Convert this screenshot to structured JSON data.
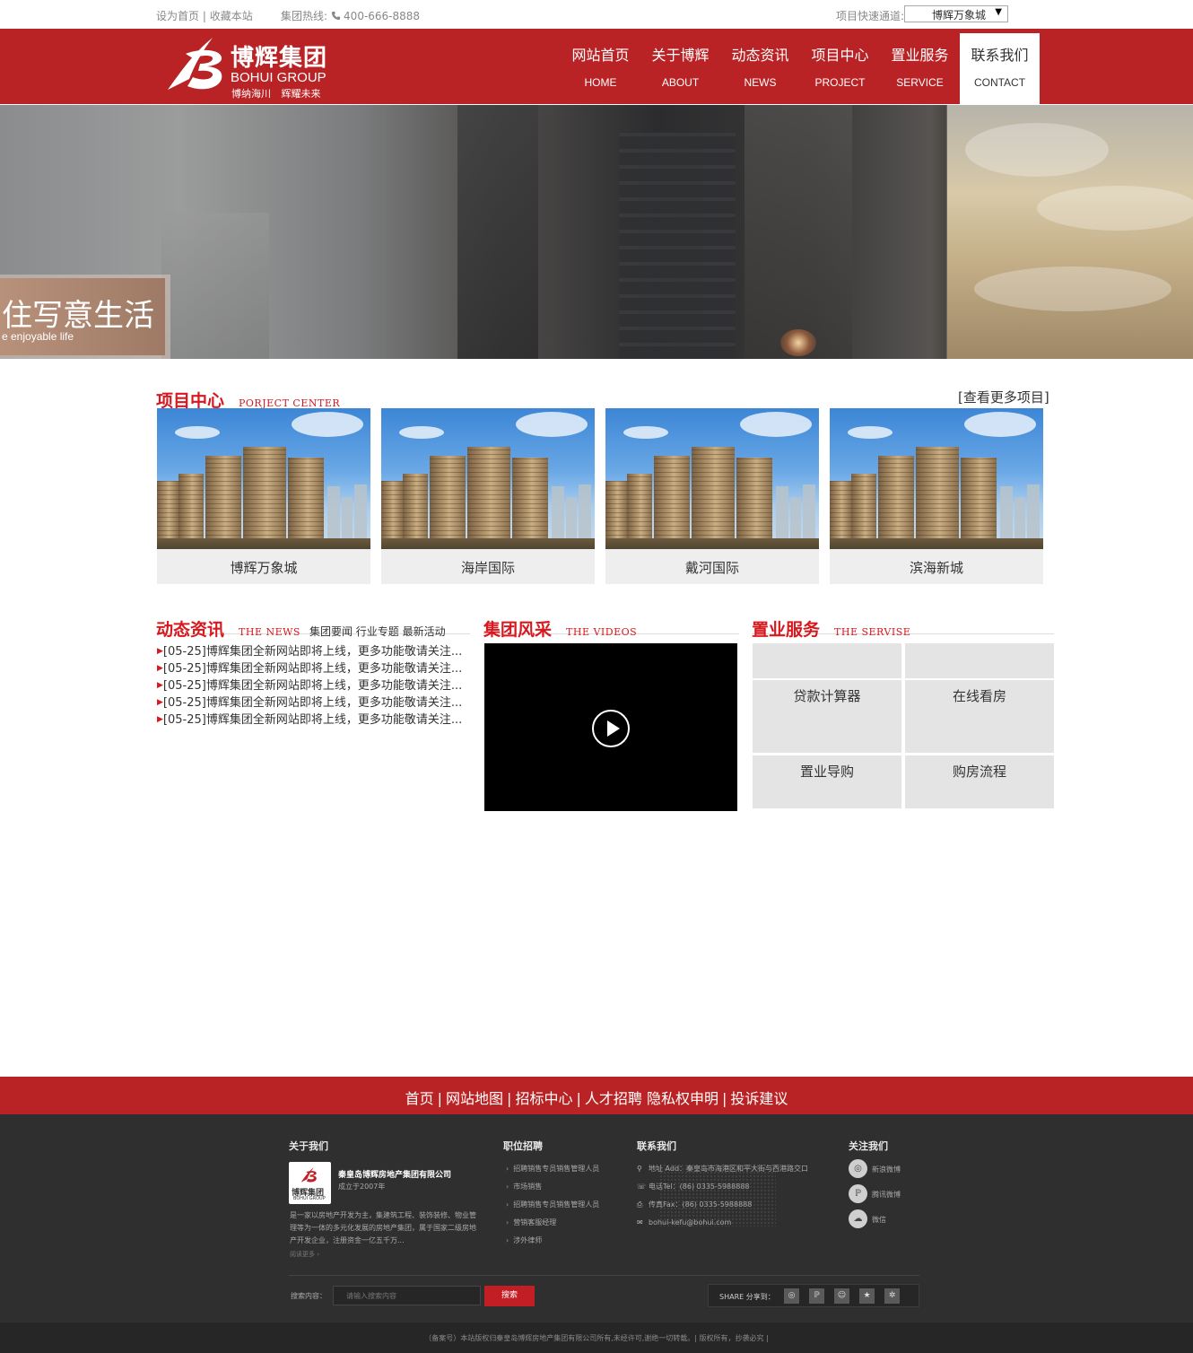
{
  "topbar": {
    "set_home": "设为首页",
    "bookmark": "收藏本站",
    "hotline_label": "集团热线:",
    "hotline": "400-666-8888",
    "quick_label": "项目快速通道:",
    "quick_selected": "博辉万象城",
    "phone_icon": "phone-icon"
  },
  "logo": {
    "cn": "博辉集团",
    "en": "BOHUI GROUP",
    "slogan": "博纳海川 辉耀未来"
  },
  "nav": [
    {
      "cn": "网站首页",
      "en": "HOME"
    },
    {
      "cn": "关于博辉",
      "en": "ABOUT"
    },
    {
      "cn": "动态资讯",
      "en": "NEWS"
    },
    {
      "cn": "项目中心",
      "en": "PROJECT"
    },
    {
      "cn": "置业服务",
      "en": "SERVICE"
    },
    {
      "cn": "联系我们",
      "en": "CONTACT"
    }
  ],
  "banner": {
    "caption_cn": "住写意生活",
    "caption_en": "e enjoyable life"
  },
  "projects": {
    "title": "项目中心",
    "title_en": "PORJECT CENTER",
    "more": "[查看更多项目]",
    "items": [
      "博辉万象城",
      "海岸国际",
      "戴河国际",
      "滨海新城"
    ]
  },
  "news": {
    "title": "动态资讯",
    "title_en": "THE NEWS",
    "tabs": "集团要闻 行业专题 最新活动",
    "items": [
      "[05-25]博辉集团全新网站即将上线，更多功能敬请关注...",
      "[05-25]博辉集团全新网站即将上线，更多功能敬请关注...",
      "[05-25]博辉集团全新网站即将上线，更多功能敬请关注...",
      "[05-25]博辉集团全新网站即将上线，更多功能敬请关注...",
      "[05-25]博辉集团全新网站即将上线，更多功能敬请关注..."
    ]
  },
  "video": {
    "title": "集团风采",
    "title_en": "THE VIDEOS"
  },
  "service": {
    "title": "置业服务",
    "title_en": "THE SERVISE",
    "items": [
      "贷款计算器",
      "在线看房",
      "置业导购",
      "购房流程"
    ]
  },
  "footnav": [
    "首页",
    "网站地图",
    "招标中心",
    "人才招聘",
    "隐私权申明",
    "投诉建议"
  ],
  "footer": {
    "about_title": "关于我们",
    "company": "秦皇岛博辉房地产集团有限公司",
    "established": "成立于2007年",
    "logo_cn": "博辉集团",
    "logo_en": "BOHUI GROUP",
    "desc": "是一家以房地产开发为主，集建筑工程、装饰装修、物业管理等为一体的多元化发展的房地产集团，属于国家二级房地产开发企业，注册资金一亿五千万...",
    "more": "阅读更多 ›",
    "jobs_title": "职位招聘",
    "jobs": [
      "招聘销售专员销售管理人员",
      "市场销售",
      "招聘销售专员销售管理人员",
      "营销客服经理",
      "涉外律师"
    ],
    "contact_title": "联系我们",
    "address": "地址 Add：秦皇岛市海港区和平大街与西港路交口",
    "tel": "电话Tel：(86) 0335-5988888",
    "fax": "传真Fax：(86) 0335-5988888",
    "email": "bohui-kefu@bohui.com",
    "follow_title": "关注我们",
    "follow": [
      "新浪微博",
      "腾讯微博",
      "微信"
    ],
    "search_label": "搜索内容：",
    "search_placeholder": "请输入搜索内容",
    "search_button": "搜索",
    "share_label": "SHARE 分享到："
  },
  "copyright": "（备案号）本站版权归秦皇岛博辉房地产集团有限公司所有,未经许可,谢绝一切转载。| 版权所有，抄袭必究 |",
  "colors": {
    "brand_red": "#b92325",
    "title_red": "#d7181e",
    "footer_dark": "#2f2f2f"
  }
}
